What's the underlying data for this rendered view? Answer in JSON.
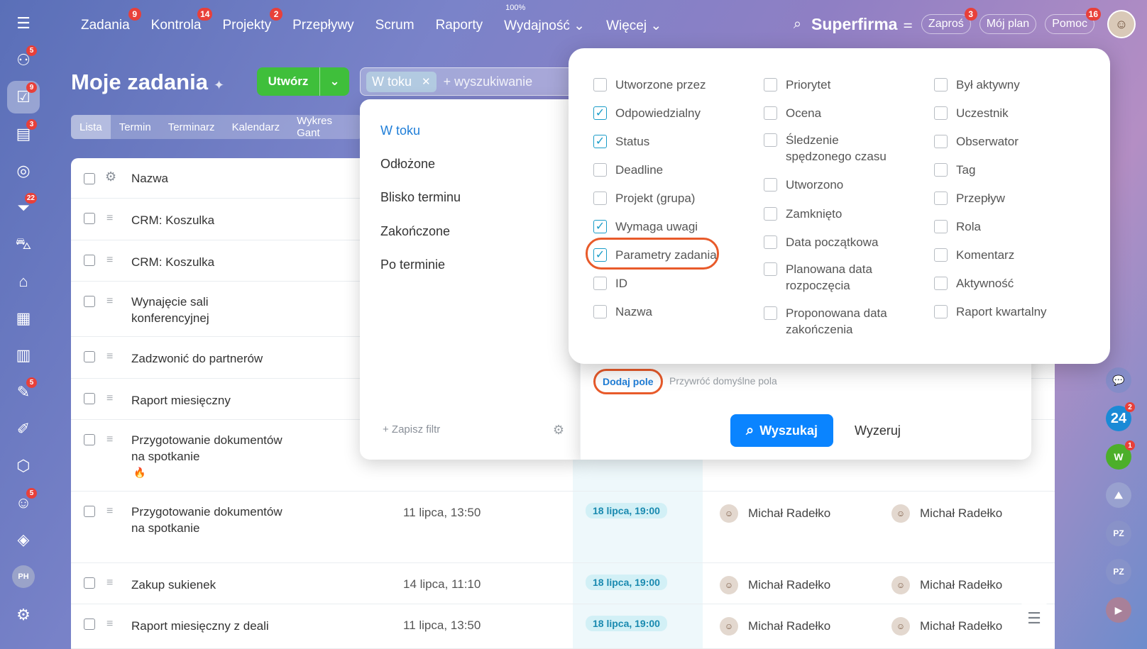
{
  "sidebar": {
    "items": [
      {
        "icon": "menu-icon",
        "badge": ""
      },
      {
        "icon": "activity-icon",
        "badge": "5"
      },
      {
        "icon": "tasks-icon",
        "badge": "9"
      },
      {
        "icon": "news-icon",
        "badge": "3"
      },
      {
        "icon": "target-icon",
        "badge": ""
      },
      {
        "icon": "funnel-icon",
        "badge": "22"
      },
      {
        "icon": "cart-icon",
        "badge": ""
      },
      {
        "icon": "store-icon",
        "badge": ""
      },
      {
        "icon": "calendar-icon",
        "badge": ""
      },
      {
        "icon": "chart-icon",
        "badge": ""
      },
      {
        "icon": "document-icon",
        "badge": "5"
      },
      {
        "icon": "sign-icon",
        "badge": ""
      },
      {
        "icon": "hexagon-icon",
        "badge": ""
      },
      {
        "icon": "robot-icon",
        "badge": "5"
      },
      {
        "icon": "box-icon",
        "badge": ""
      }
    ],
    "user_initials": "PH"
  },
  "topnav": {
    "items": [
      {
        "label": "Zadania",
        "badge": "9"
      },
      {
        "label": "Kontrola",
        "badge": "14"
      },
      {
        "label": "Projekty",
        "badge": "2"
      },
      {
        "label": "Przepływy",
        "badge": ""
      },
      {
        "label": "Scrum",
        "badge": ""
      },
      {
        "label": "Raporty",
        "badge": ""
      },
      {
        "label": "Wydajność ⌄",
        "badge": ""
      },
      {
        "label": "Więcej ⌄",
        "badge": ""
      }
    ],
    "efficiency_sup": "100%",
    "brand": "Superfirma",
    "invite": "Zaproś",
    "invite_badge": "3",
    "my_plan": "Mój plan",
    "help": "Pomoc",
    "help_badge": "16"
  },
  "page": {
    "title": "Moje zadania",
    "create_label": "Utwórz",
    "filter_chip": "W toku",
    "search_placeholder": "+ wyszukiwanie",
    "views": [
      "Lista",
      "Termin",
      "Terminarz",
      "Kalendarz",
      "Wykres Gant"
    ]
  },
  "table": {
    "header_name": "Nazwa",
    "rows": [
      {
        "name": "CRM: Koszulka",
        "date": "",
        "deadline": "",
        "user1": "",
        "user2": ""
      },
      {
        "name": "CRM: Koszulka",
        "date": "",
        "deadline": "",
        "user1": "",
        "user2": ""
      },
      {
        "name": "Wynajęcie sali konferencyjnej",
        "date": "",
        "deadline": "",
        "user1": "",
        "user2": ""
      },
      {
        "name": "Zadzwonić do partnerów",
        "date": "",
        "deadline": "",
        "user1": "",
        "user2": ""
      },
      {
        "name": "Raport miesięczny",
        "date": "",
        "deadline": "",
        "user1": "",
        "user2": ""
      },
      {
        "name": "Przygotowanie dokumentów na spotkanie",
        "date": "",
        "deadline": "",
        "user1": "",
        "user2": ""
      },
      {
        "name": "Przygotowanie dokumentów na spotkanie",
        "date": "11 lipca, 13:50",
        "deadline": "18 lipca, 19:00",
        "user1": "Michał Radełko",
        "user2": "Michał Radełko"
      },
      {
        "name": "Zakup sukienek",
        "date": "14 lipca, 11:10",
        "deadline": "18 lipca, 19:00",
        "user1": "Michał Radełko",
        "user2": "Michał Radełko"
      },
      {
        "name": "Raport miesięczny z deali",
        "date": "11 lipca, 13:50",
        "deadline": "18 lipca, 19:00",
        "user1": "Michał Radełko",
        "user2": "Michał Radełko"
      }
    ]
  },
  "filter_presets": {
    "items": [
      "W toku",
      "Odłożone",
      "Blisko terminu",
      "Zakończone",
      "Po terminie"
    ],
    "save_filter": "+ Zapisz filtr"
  },
  "filter_actions": {
    "add_field": "Dodaj pole",
    "restore": "Przywróć domyślne pola",
    "search": "Wyszukaj",
    "reset": "Wyzeruj"
  },
  "field_chooser": {
    "col1": [
      {
        "label": "Utworzone przez",
        "checked": false
      },
      {
        "label": "Odpowiedzialny",
        "checked": true
      },
      {
        "label": "Status",
        "checked": true
      },
      {
        "label": "Deadline",
        "checked": false
      },
      {
        "label": "Projekt (grupa)",
        "checked": false
      },
      {
        "label": "Wymaga uwagi",
        "checked": true
      },
      {
        "label": "Parametry zadania",
        "checked": true
      },
      {
        "label": "ID",
        "checked": false
      },
      {
        "label": "Nazwa",
        "checked": false
      }
    ],
    "col2": [
      {
        "label": "Priorytet",
        "checked": false
      },
      {
        "label": "Ocena",
        "checked": false
      },
      {
        "label": "Śledzenie spędzonego czasu",
        "checked": false
      },
      {
        "label": "Utworzono",
        "checked": false
      },
      {
        "label": "Zamknięto",
        "checked": false
      },
      {
        "label": "Data początkowa",
        "checked": false
      },
      {
        "label": "Planowana data rozpoczęcia",
        "checked": false
      },
      {
        "label": "Proponowana data zakończenia",
        "checked": false
      }
    ],
    "col3": [
      {
        "label": "Był aktywny",
        "checked": false
      },
      {
        "label": "Uczestnik",
        "checked": false
      },
      {
        "label": "Obserwator",
        "checked": false
      },
      {
        "label": "Tag",
        "checked": false
      },
      {
        "label": "Przepływ",
        "checked": false
      },
      {
        "label": "Rola",
        "checked": false
      },
      {
        "label": "Komentarz",
        "checked": false
      },
      {
        "label": "Aktywność",
        "checked": false
      },
      {
        "label": "Raport kwartalny",
        "checked": false
      }
    ]
  },
  "right_strip": {
    "b24_label": "24",
    "b24_badge": "2",
    "w_label": "W",
    "w_badge": "1",
    "pz1": "PZ",
    "pz2": "PZ"
  },
  "colors": {
    "accent": "#0a84ff",
    "create": "#3fbf3b",
    "badge": "#e8403a",
    "highlight": "#e85a2a"
  }
}
